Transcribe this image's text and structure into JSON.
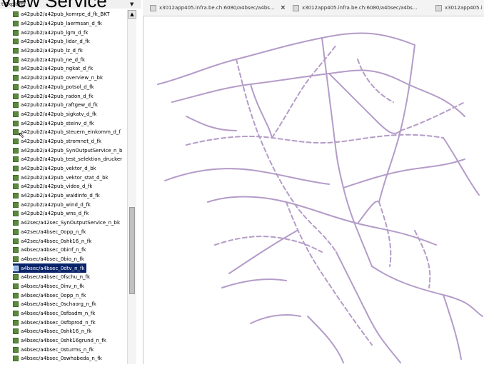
{
  "overlay_title": "View Service",
  "explorer": {
    "header": "t Explorer",
    "header_arrow": "▼",
    "items": [
      {
        "label": "a42pub2/a42pub_komrpe_d_fk_BKT"
      },
      {
        "label": "a42pub2/a42pub_laermsan_d_fk"
      },
      {
        "label": "a42pub2/a42pub_lgm_d_fk"
      },
      {
        "label": "a42pub2/a42pub_lidar_d_fk"
      },
      {
        "label": "a42pub2/a42pub_lz_d_fk"
      },
      {
        "label": "a42pub2/a42pub_ne_d_fk"
      },
      {
        "label": "a42pub2/a42pub_ngkat_d_fk"
      },
      {
        "label": "a42pub2/a42pub_overview_n_bk"
      },
      {
        "label": "a42pub2/a42pub_potsol_d_fk"
      },
      {
        "label": "a42pub2/a42pub_radon_d_fk"
      },
      {
        "label": "a42pub2/a42pub_raftgew_d_fk"
      },
      {
        "label": "a42pub2/a42pub_sigkatv_d_fk"
      },
      {
        "label": "a42pub2/a42pub_steinv_d_fk"
      },
      {
        "label": "a42pub2/a42pub_steuern_einkomm_d_f"
      },
      {
        "label": "a42pub2/a42pub_stromnet_d_fk"
      },
      {
        "label": "a42pub2/a42pub_SynOutputService_n_b"
      },
      {
        "label": "a42pub2/a42pub_test_selektion_drucker"
      },
      {
        "label": "a42pub2/a42pub_vektor_d_bk"
      },
      {
        "label": "a42pub2/a42pub_vektor_stat_d_bk"
      },
      {
        "label": "a42pub2/a42pub_video_d_fk"
      },
      {
        "label": "a42pub2/a42pub_waldinfo_d_fk"
      },
      {
        "label": "a42pub2/a42pub_wind_d_fk"
      },
      {
        "label": "a42pub2/a42pub_wns_d_fk"
      },
      {
        "label": "a42sec/a42sec_SynOutputService_n_bk"
      },
      {
        "label": "a42sec/a4bsec_0opp_n_fk"
      },
      {
        "label": "a42sec/a4bsec_0shk16_n_fk"
      },
      {
        "label": "a4bsec/a4bsec_0binf_n_fk"
      },
      {
        "label": "a4bsec/a4bsec_0bio_n_fk"
      },
      {
        "label": "a4bsec/a4bsec_0dtv_n_fk",
        "selected": true
      },
      {
        "label": "a4bsec/a4bsec_0fschu_n_fk"
      },
      {
        "label": "a4bsec/a4bsec_0inv_n_fk"
      },
      {
        "label": "a4bsec/a4bsec_0opp_n_fk"
      },
      {
        "label": "a4bsec/a4bsec_0schaorg_n_fk"
      },
      {
        "label": "a4bsec/a4bsec_0sfbadm_n_fk"
      },
      {
        "label": "a4bsec/a4bsec_0sfbprod_n_fk"
      },
      {
        "label": "a4bsec/a4bsec_0shk16_n_fk"
      },
      {
        "label": "a4bsec/a4bsec_0shk16grund_n_fk"
      },
      {
        "label": "a4bsec/a4bsec_0sturms_n_fk"
      },
      {
        "label": "a4bsec/a4bsec_0swhabeda_n_fk"
      }
    ]
  },
  "tabs": [
    {
      "label": "x3012app405.infra.be.ch:6080/a4bsec/a4bs...",
      "close": "×"
    },
    {
      "label": "x3012app405.infra.be.ch:6080/a4bsec/a4bs...",
      "close": ""
    },
    {
      "label": "x3012app405.i",
      "close": ""
    }
  ],
  "map": {
    "line_color": "#b49cc8",
    "background": "#ffffff"
  },
  "colors": {
    "selection": "#0a246a",
    "layer_icon": "#5a8a3a"
  }
}
